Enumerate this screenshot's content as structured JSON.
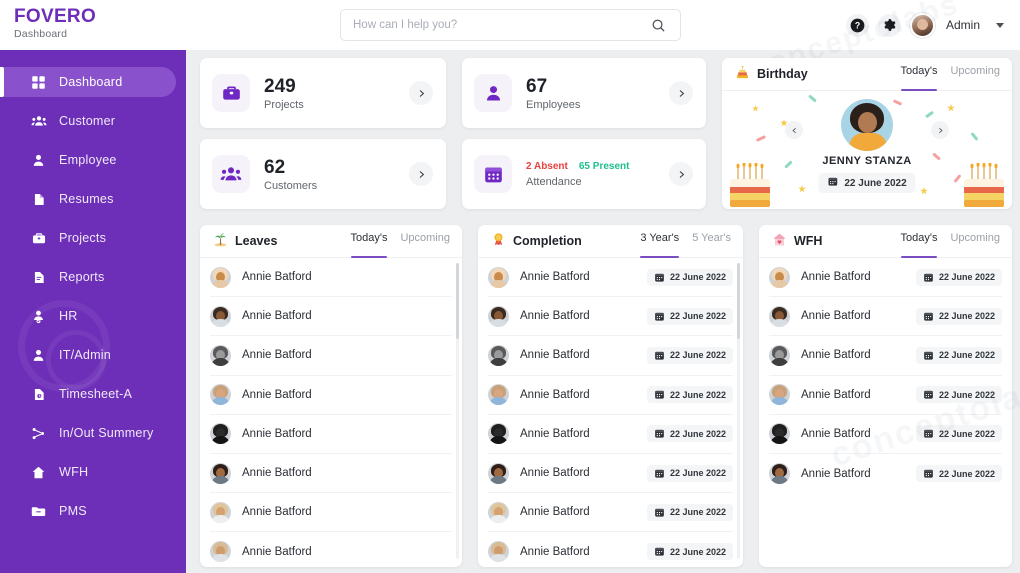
{
  "brand": {
    "title": "FOVERO",
    "subtitle": "Dashboard"
  },
  "search": {
    "placeholder": "How can I help you?",
    "value": "",
    "icon": "search-icon"
  },
  "topbar": {
    "help_icon": "help-circle-icon",
    "settings_icon": "gear-icon",
    "admin_label": "Admin",
    "caret_icon": "chevron-down-icon"
  },
  "sidebar": {
    "items": [
      {
        "label": "Dashboard",
        "icon": "grid-icon",
        "active": true
      },
      {
        "label": "Customer",
        "icon": "users-icon",
        "active": false
      },
      {
        "label": "Employee",
        "icon": "user-icon",
        "active": false
      },
      {
        "label": "Resumes",
        "icon": "document-icon",
        "active": false
      },
      {
        "label": "Projects",
        "icon": "briefcase-icon",
        "active": false
      },
      {
        "label": "Reports",
        "icon": "report-icon",
        "active": false
      },
      {
        "label": "HR",
        "icon": "user-badge-icon",
        "active": false
      },
      {
        "label": "IT/Admin",
        "icon": "user-icon",
        "active": false
      },
      {
        "label": "Timesheet-A",
        "icon": "file-clock-icon",
        "active": false
      },
      {
        "label": "In/Out Summery",
        "icon": "shuffle-icon",
        "active": false
      },
      {
        "label": "WFH",
        "icon": "home-icon",
        "active": false
      },
      {
        "label": "PMS",
        "icon": "folder-icon",
        "active": false
      }
    ]
  },
  "stats": [
    {
      "value": "249",
      "label": "Projects",
      "icon": "briefcase-icon",
      "chevron": "chevron-right-icon"
    },
    {
      "value": "62",
      "label": "Customers",
      "icon": "users-icon",
      "chevron": "chevron-right-icon"
    },
    {
      "value": "67",
      "label": "Employees",
      "icon": "user-icon",
      "chevron": "chevron-right-icon"
    }
  ],
  "attendance": {
    "absent": "2 Absent",
    "present": "65 Present",
    "label": "Attendance",
    "icon": "calendar-icon",
    "chevron": "chevron-right-icon",
    "absent_color": "#e8413f",
    "present_color": "#1fbf8f"
  },
  "birthday": {
    "title": "Birthday",
    "icon": "cake-icon",
    "tabs": [
      {
        "label": "Today's",
        "active": true
      },
      {
        "label": "Upcoming",
        "active": false
      }
    ],
    "person_name": "JENNY STANZA",
    "date": "22 June 2022",
    "date_icon": "calendar-icon",
    "prev_icon": "chevron-left-icon",
    "next_icon": "chevron-right-icon"
  },
  "panels": [
    {
      "key": "leaves",
      "title": "Leaves",
      "icon": "palm-tree-icon",
      "tabs": [
        {
          "label": "Today's",
          "active": true
        },
        {
          "label": "Upcoming",
          "active": false
        }
      ],
      "show_dates": false,
      "rows": [
        {
          "name": "Annie Batford"
        },
        {
          "name": "Annie Batford"
        },
        {
          "name": "Annie Batford"
        },
        {
          "name": "Annie Batford"
        },
        {
          "name": "Annie Batford"
        },
        {
          "name": "Annie Batford"
        },
        {
          "name": "Annie Batford"
        },
        {
          "name": "Annie Batford"
        }
      ]
    },
    {
      "key": "completion",
      "title": "Completion",
      "icon": "award-icon",
      "tabs": [
        {
          "label": "3 Year's",
          "active": true
        },
        {
          "label": "5 Year's",
          "active": false
        }
      ],
      "show_dates": true,
      "rows": [
        {
          "name": "Annie Batford",
          "date": "22 June 2022"
        },
        {
          "name": "Annie Batford",
          "date": "22 June 2022"
        },
        {
          "name": "Annie Batford",
          "date": "22 June 2022"
        },
        {
          "name": "Annie Batford",
          "date": "22 June 2022"
        },
        {
          "name": "Annie Batford",
          "date": "22 June 2022"
        },
        {
          "name": "Annie Batford",
          "date": "22 June 2022"
        },
        {
          "name": "Annie Batford",
          "date": "22 June 2022"
        },
        {
          "name": "Annie Batford",
          "date": "22 June 2022"
        }
      ]
    },
    {
      "key": "wfh",
      "title": "WFH",
      "icon": "home-heart-icon",
      "tabs": [
        {
          "label": "Today's",
          "active": true
        },
        {
          "label": "Upcoming",
          "active": false
        }
      ],
      "show_dates": true,
      "rows": [
        {
          "name": "Annie Batford",
          "date": "22 June 2022"
        },
        {
          "name": "Annie Batford",
          "date": "22 June 2022"
        },
        {
          "name": "Annie Batford",
          "date": "22 June 2022"
        },
        {
          "name": "Annie Batford",
          "date": "22 June 2022"
        },
        {
          "name": "Annie Batford",
          "date": "22 June 2022"
        },
        {
          "name": "Annie Batford",
          "date": "22 June 2022"
        }
      ]
    }
  ],
  "colors": {
    "sidebar": "#6d2eb8",
    "sidebar_active": "#8a51cc",
    "brand": "#6d2eb8",
    "accent": "#7a4ec0",
    "page_bg": "#eceef0"
  }
}
